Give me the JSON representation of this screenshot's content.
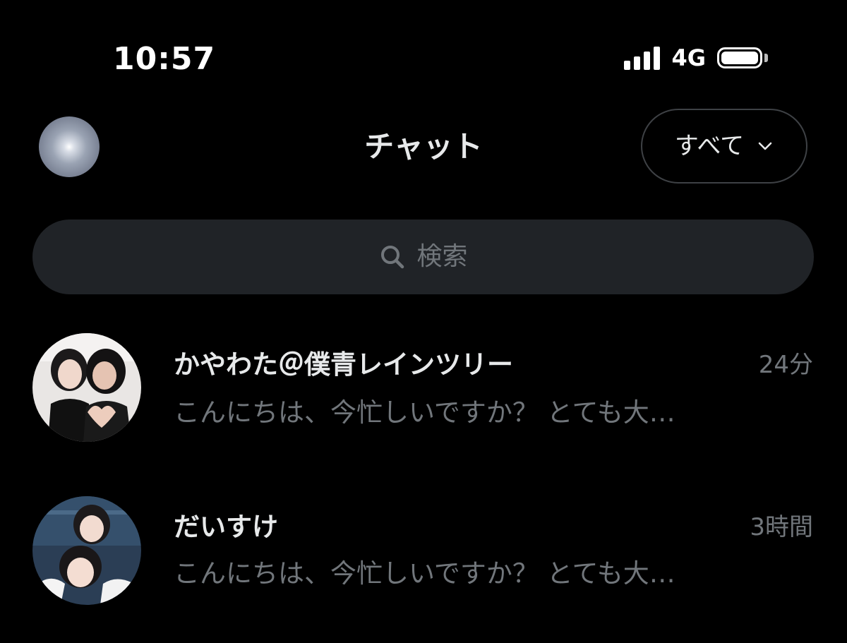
{
  "status_bar": {
    "time": "10:57",
    "network": "4G",
    "signal_bars": 4,
    "battery_level": 1.0,
    "icons": [
      "signal-icon",
      "battery-icon"
    ]
  },
  "header": {
    "title": "チャット",
    "filter": {
      "label": "すべて",
      "icon": "chevron-down-icon"
    }
  },
  "search": {
    "placeholder": "検索",
    "icon": "search-icon"
  },
  "chats": [
    {
      "name": "かやわた＠僕青レインツリー",
      "time": "24分",
      "preview": "こんにちは、今忙しいですか？ とても大…"
    },
    {
      "name": "だいすけ",
      "time": "3時間",
      "preview": "こんにちは、今忙しいですか？ とても大…"
    }
  ],
  "colors": {
    "background": "#000000",
    "primary_text": "#e7e9ea",
    "secondary_text": "#71767b",
    "search_background": "#202327",
    "button_border": "#3e4145"
  }
}
